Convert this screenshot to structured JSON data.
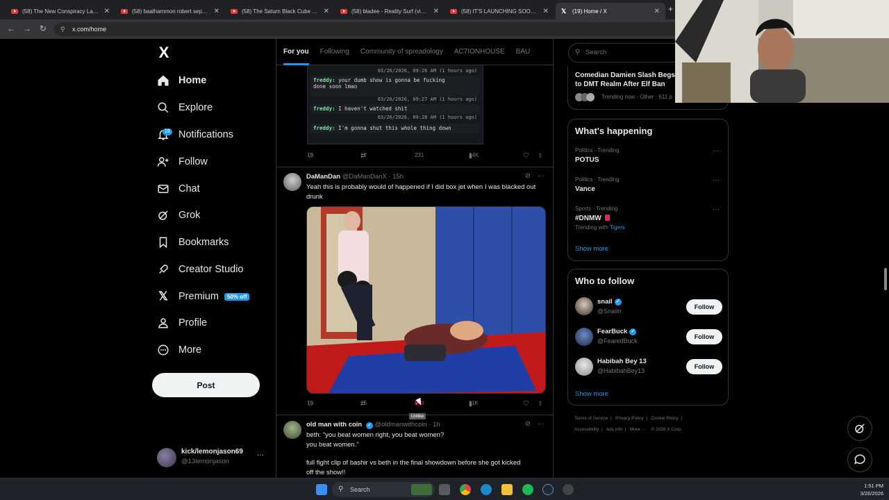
{
  "browser": {
    "tabs": [
      {
        "title": "(58) The New Conspiracy Landscape"
      },
      {
        "title": "(58) baalhammon robert sepher"
      },
      {
        "title": "(58) The Saturn Black Cube Time"
      },
      {
        "title": "(58) bladee - Reality Surf (video)"
      },
      {
        "title": "(58) IT'S LAUNCHING SOON! W"
      },
      {
        "title": "(19) Home / X"
      }
    ],
    "url": "x.com/home"
  },
  "nav": {
    "logo": "X",
    "items": [
      {
        "label": "Home",
        "icon": "home-icon"
      },
      {
        "label": "Explore",
        "icon": "search-icon"
      },
      {
        "label": "Notifications",
        "icon": "bell-icon",
        "badge": "19"
      },
      {
        "label": "Follow",
        "icon": "add-person-icon"
      },
      {
        "label": "Chat",
        "icon": "mail-icon"
      },
      {
        "label": "Grok",
        "icon": "grok-icon"
      },
      {
        "label": "Bookmarks",
        "icon": "bookmark-icon"
      },
      {
        "label": "Creator Studio",
        "icon": "rocket-icon"
      },
      {
        "label": "Premium",
        "icon": "x-icon",
        "pill": "50% off"
      },
      {
        "label": "Profile",
        "icon": "person-icon"
      },
      {
        "label": "More",
        "icon": "more-circle-icon"
      }
    ],
    "post_label": "Post",
    "account": {
      "name": "kick/lemonjason69",
      "handle": "@13lemonjason",
      "more": "···"
    }
  },
  "feed": {
    "tabs": [
      "For you",
      "Following",
      "Community of spreadology",
      "AC7IONHOUSE",
      "BAU"
    ],
    "chat_snippet": {
      "lines": [
        {
          "stamp": "03/26/2026, 09:26 AM (1 hours ago)"
        },
        {
          "name": "freddy:",
          "text": "your dumb show is gonna be fucking",
          "text2": "done soon lmao",
          "stamp": "03/26/2026, 09:27 AM (1 hours ago)"
        },
        {
          "name": "freddy:",
          "text": "I haven't watched shit",
          "stamp": "03/26/2026, 09:28 AM (1 hours ago)"
        },
        {
          "name": "freddy:",
          "text": "I'm gonna shut this whole thing down"
        }
      ]
    },
    "first_actions": {
      "replies": "18",
      "reposts": "12",
      "likes": "231",
      "views": "14K"
    },
    "tweet2": {
      "name": "DaManDan",
      "handle": "@DaManDanX · 15h",
      "text": "Yeah this is probably would of happened if I did box jet when I was blacked out drunk",
      "actions": {
        "replies": "16",
        "reposts": "15",
        "likes": "598",
        "views": "11K"
      },
      "tooltip": "Unlike"
    },
    "tweet3": {
      "name": "old man with coin",
      "handle": "@oldmanwithcoin · 1h",
      "line1": "beth: \"you beat women right, you beat women?",
      "line2": "you beat women.\"",
      "line3": "full fight clip of bashir vs beth in the final showdown before she got kicked",
      "line4": "off the show!!"
    }
  },
  "sidebar": {
    "search_placeholder": "Search",
    "top_story": {
      "title": "Comedian Damien Slash Begs",
      "title2": "to DMT Realm After Elf Ban",
      "meta": "Trending now · Other · 611 p"
    },
    "happening": {
      "title": "What's happening",
      "trends": [
        {
          "meta": "Politics · Trending",
          "title": "POTUS"
        },
        {
          "meta": "Politics · Trending",
          "title": "Vance"
        },
        {
          "meta": "Sports · Trending",
          "title": "#DNMW",
          "extra_pre": "Trending with",
          "extra": "Tigers"
        }
      ],
      "show_more": "Show more"
    },
    "who_to_follow": {
      "title": "Who to follow",
      "users": [
        {
          "name": "snail",
          "handle": "@Snailrr",
          "verified": true,
          "button": "Follow"
        },
        {
          "name": "FearBuck",
          "handle": "@FearedBuck",
          "verified": true,
          "button": "Follow"
        },
        {
          "name": "Habibah Bey 13",
          "handle": "@HabibahBey13",
          "verified": false,
          "button": "Follow"
        }
      ],
      "show_more": "Show more"
    },
    "footer": {
      "row1": [
        "Terms of Service",
        "Privacy Policy",
        "Cookie Policy"
      ],
      "row2": [
        "Accessibility",
        "Ads info",
        "More ···",
        "© 2026 X Corp."
      ]
    }
  },
  "taskbar": {
    "search": "Search",
    "time": "1:51 PM",
    "date": "3/26/2026"
  },
  "colors": {
    "accent": "#1d9bf0",
    "like": "#f91880",
    "bg": "#000000"
  }
}
